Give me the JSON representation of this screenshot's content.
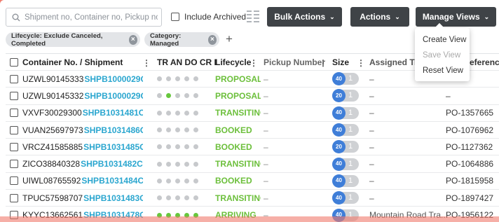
{
  "toolbar": {
    "search_placeholder": "Shipment no, Container no, Pickup no",
    "include_archived": "Include Archived",
    "bulk_actions": "Bulk Actions",
    "actions": "Actions",
    "manage_views": "Manage Views"
  },
  "filters": [
    {
      "label": "Lifecycle: Exclude Canceled, Completed"
    },
    {
      "label": "Category: Managed"
    }
  ],
  "add_filter": "+",
  "views_menu": {
    "items": [
      {
        "label": "Create View",
        "enabled": true
      },
      {
        "label": "Save View",
        "enabled": false
      },
      {
        "label": "Reset View",
        "enabled": true
      }
    ]
  },
  "table": {
    "headers": {
      "container": "Container No. / Shipment",
      "statuses": "TR AN DO CR FR",
      "lifecycle": "Lifecycle",
      "pickup": "Pickup Number",
      "size": "Size",
      "truck": "Assigned Truc",
      "reference": "eferenc"
    },
    "rows": [
      {
        "container": "UZWL90145333",
        "shipment": "SHPB1000029C",
        "dots": [
          false,
          false,
          false,
          false,
          false
        ],
        "lifecycle": "PROPOSAL",
        "pickup": "–",
        "size": "40",
        "count": "1",
        "truck": "–",
        "reference": ""
      },
      {
        "container": "UZWL90145332",
        "shipment": "SHPB1000029C",
        "dots": [
          false,
          true,
          false,
          false,
          false
        ],
        "lifecycle": "PROPOSAL",
        "pickup": "–",
        "size": "20",
        "count": "1",
        "truck": "–",
        "reference": "–"
      },
      {
        "container": "VXVF30029300",
        "shipment": "SHPB1031481C",
        "dots": [
          false,
          false,
          false,
          false,
          false
        ],
        "lifecycle": "TRANSITING",
        "pickup": "–",
        "size": "40",
        "count": "1",
        "truck": "–",
        "reference": "PO-1357665"
      },
      {
        "container": "VUAN25697973",
        "shipment": "SHPB1031486C",
        "dots": [
          false,
          false,
          false,
          false,
          false
        ],
        "lifecycle": "BOOKED",
        "pickup": "–",
        "size": "40",
        "count": "1",
        "truck": "–",
        "reference": "PO-1076962"
      },
      {
        "container": "VRCZ41585885",
        "shipment": "SHPB1031485C",
        "dots": [
          false,
          false,
          false,
          false,
          false
        ],
        "lifecycle": "BOOKED",
        "pickup": "–",
        "size": "20",
        "count": "1",
        "truck": "–",
        "reference": "PO-1127362"
      },
      {
        "container": "ZICO38840328",
        "shipment": "SHPB1031482C",
        "dots": [
          false,
          false,
          false,
          false,
          false
        ],
        "lifecycle": "TRANSITING",
        "pickup": "–",
        "size": "40",
        "count": "1",
        "truck": "–",
        "reference": "PO-1064886"
      },
      {
        "container": "UIWL08765592",
        "shipment": "SHPB1031484C",
        "dots": [
          false,
          false,
          false,
          false,
          false
        ],
        "lifecycle": "BOOKED",
        "pickup": "–",
        "size": "40",
        "count": "1",
        "truck": "–",
        "reference": "PO-1815958"
      },
      {
        "container": "TPUC57598707",
        "shipment": "SHPB1031483C",
        "dots": [
          false,
          false,
          false,
          false,
          false
        ],
        "lifecycle": "TRANSITING",
        "pickup": "–",
        "size": "40",
        "count": "1",
        "truck": "–",
        "reference": "PO-1897427"
      },
      {
        "container": "KYYC13662561",
        "shipment": "SHPB1031478C",
        "dots": [
          true,
          true,
          true,
          true,
          true
        ],
        "lifecycle": "ARRIVING",
        "pickup": "–",
        "size": "40",
        "count": "1",
        "truck": "Mountain Road Tra...",
        "reference": "PO-1956122"
      }
    ]
  },
  "colors": {
    "accent_blue": "#2aa6cf",
    "lifecycle_green": "#6cbf3b",
    "dark_button": "#3f4347",
    "background": "#f07a6c"
  }
}
